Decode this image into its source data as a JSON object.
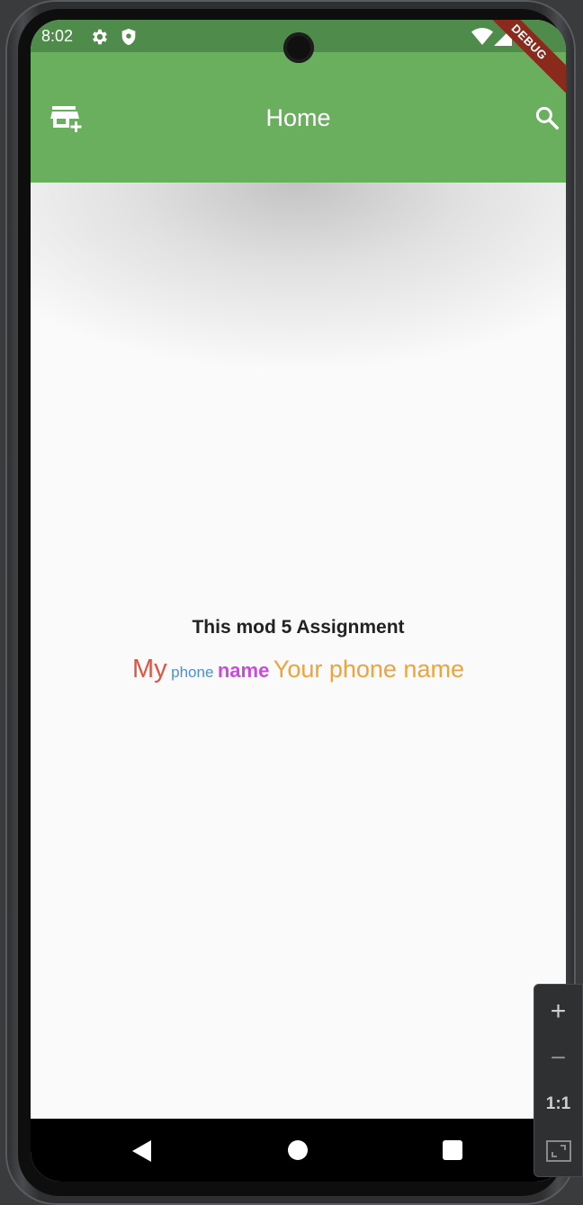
{
  "status_bar": {
    "time": "8:02",
    "left_icons": [
      "settings-icon",
      "shield-icon"
    ],
    "right_icons": [
      "wifi-icon",
      "signal-icon",
      "battery-icon"
    ]
  },
  "appbar": {
    "title": "Home",
    "left_icon": "add-business-icon",
    "right_icon": "search-icon",
    "background": "#6aaf5e"
  },
  "debug_banner": "DEBUG",
  "body": {
    "title": "This mod 5 Assignment",
    "rich_text": {
      "my": "My",
      "phone": "phone",
      "name": "name",
      "your_phone_name": "Your phone name"
    }
  },
  "navbar": {
    "icons": [
      "back-icon",
      "home-icon",
      "recents-icon"
    ]
  },
  "zoom_controls": {
    "zoom_in": "+",
    "zoom_out": "−",
    "actual_size": "1:1",
    "icons": [
      "zoom-in-icon",
      "zoom-out-icon",
      "actual-size-icon",
      "fit-screen-icon"
    ]
  }
}
